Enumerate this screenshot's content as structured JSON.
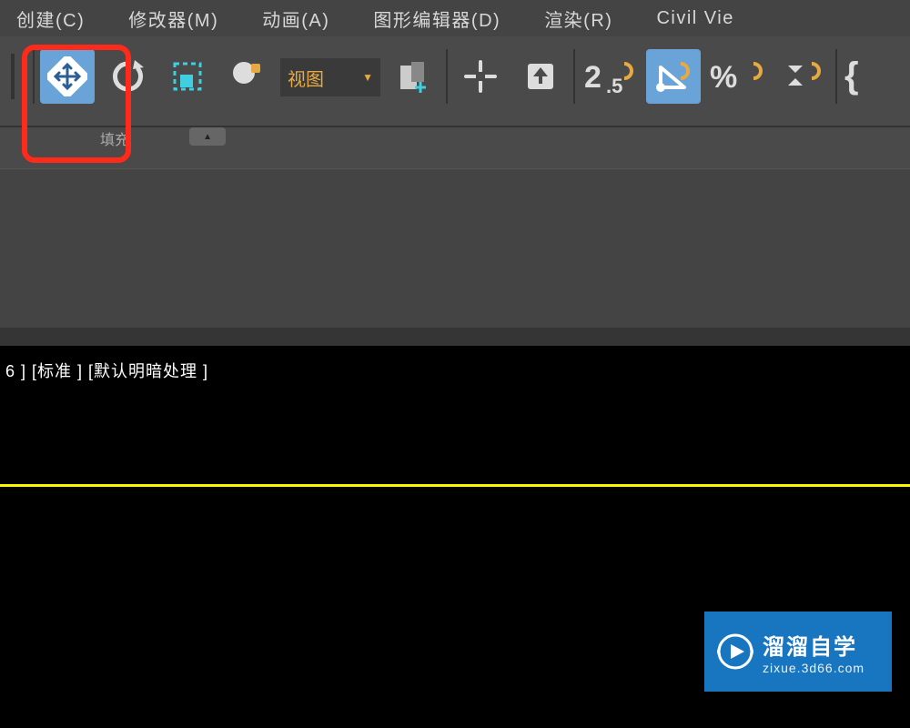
{
  "menu": {
    "create": "创建(C)",
    "modifiers": "修改器(M)",
    "animation": "动画(A)",
    "graph_editors": "图形编辑器(D)",
    "rendering": "渲染(R)",
    "civil_view": "Civil Vie"
  },
  "toolbar": {
    "coord_label": "视图",
    "secondary_label": "填充"
  },
  "viewport": {
    "label": "6 ] [标准 ] [默认明暗处理 ]"
  },
  "watermark": {
    "title": "溜溜自学",
    "url": "zixue.3d66.com"
  },
  "icons": {
    "move": "move-icon",
    "rotate": "rotate-icon",
    "scale": "scale-icon",
    "placement": "placement-icon",
    "coord": "coord-icon",
    "selection_lock": "selection-lock-icon",
    "align_pivot": "pivot-icon",
    "align_up": "align-up-icon",
    "snap": "snap-icon",
    "angle_snap": "angle-snap-icon",
    "percent_snap": "percent-snap-icon",
    "spinner_snap": "spinner-snap-icon",
    "brace": "brace-icon"
  }
}
